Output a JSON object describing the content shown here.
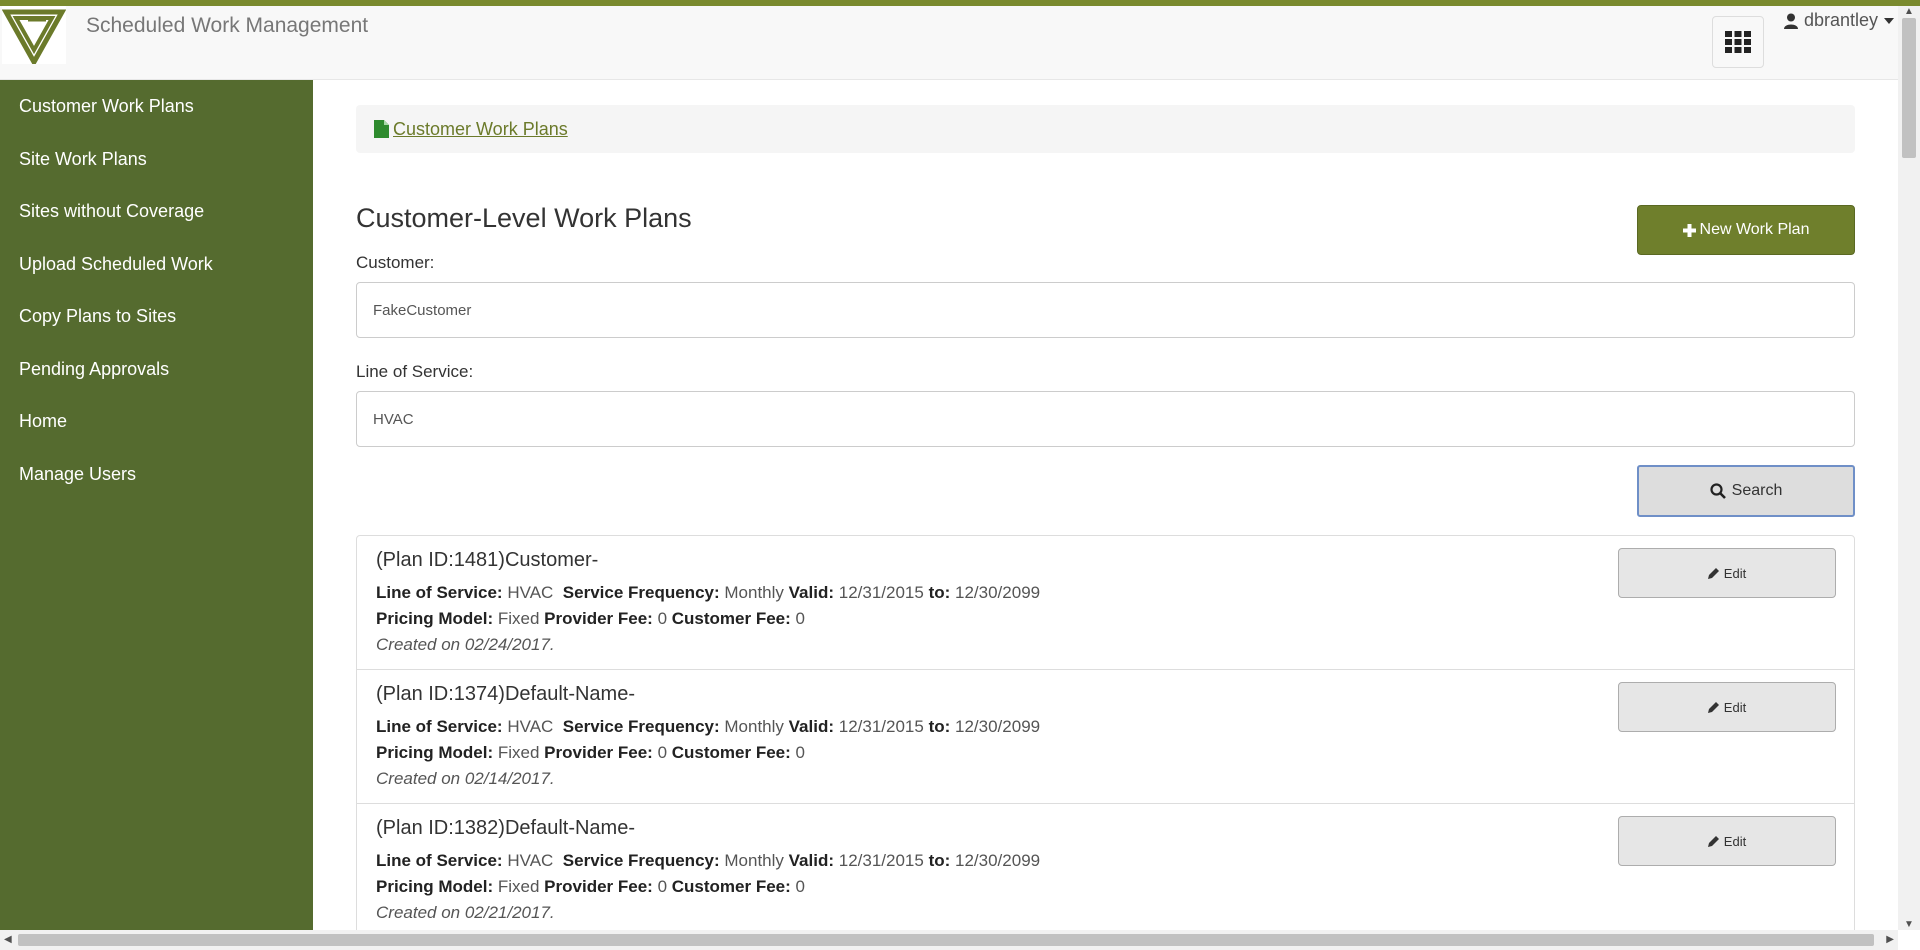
{
  "app": {
    "title": "Scheduled Work Management",
    "user": "dbrantley",
    "accent_color": "#7a8a2e",
    "sidebar_color": "#556b2f"
  },
  "sidebar": {
    "items": [
      {
        "label": "Customer Work Plans"
      },
      {
        "label": "Site Work Plans"
      },
      {
        "label": "Sites without Coverage"
      },
      {
        "label": "Upload Scheduled Work"
      },
      {
        "label": "Copy Plans to Sites"
      },
      {
        "label": "Pending Approvals"
      },
      {
        "label": "Home"
      },
      {
        "label": "Manage Users"
      }
    ]
  },
  "breadcrumb": {
    "label": "Customer Work Plans",
    "icon": "file-icon"
  },
  "page": {
    "title": "Customer-Level Work Plans",
    "new_button_label": "New Work Plan",
    "customer_label": "Customer:",
    "customer_value": "FakeCustomer",
    "los_label": "Line of Service:",
    "los_value": "HVAC",
    "search_label": "Search"
  },
  "plans": [
    {
      "title": "(Plan ID:1481)Customer-",
      "line_of_service": "HVAC",
      "service_frequency": "Monthly",
      "valid_from": "12/31/2015",
      "valid_to": "12/30/2099",
      "pricing_model": "Fixed",
      "provider_fee": "0",
      "customer_fee": "0",
      "created": "Created on 02/24/2017.",
      "edit_label": "Edit"
    },
    {
      "title": "(Plan ID:1374)Default-Name-",
      "line_of_service": "HVAC",
      "service_frequency": "Monthly",
      "valid_from": "12/31/2015",
      "valid_to": "12/30/2099",
      "pricing_model": "Fixed",
      "provider_fee": "0",
      "customer_fee": "0",
      "created": "Created on 02/14/2017.",
      "edit_label": "Edit"
    },
    {
      "title": "(Plan ID:1382)Default-Name-",
      "line_of_service": "HVAC",
      "service_frequency": "Monthly",
      "valid_from": "12/31/2015",
      "valid_to": "12/30/2099",
      "pricing_model": "Fixed",
      "provider_fee": "0",
      "customer_fee": "0",
      "created": "Created on 02/21/2017.",
      "edit_label": "Edit"
    }
  ],
  "labels": {
    "line_of_service": "Line of Service:",
    "service_frequency": "Service Frequency:",
    "valid": "Valid:",
    "to": "to:",
    "pricing_model": "Pricing Model:",
    "provider_fee": "Provider Fee:",
    "customer_fee": "Customer Fee:"
  }
}
